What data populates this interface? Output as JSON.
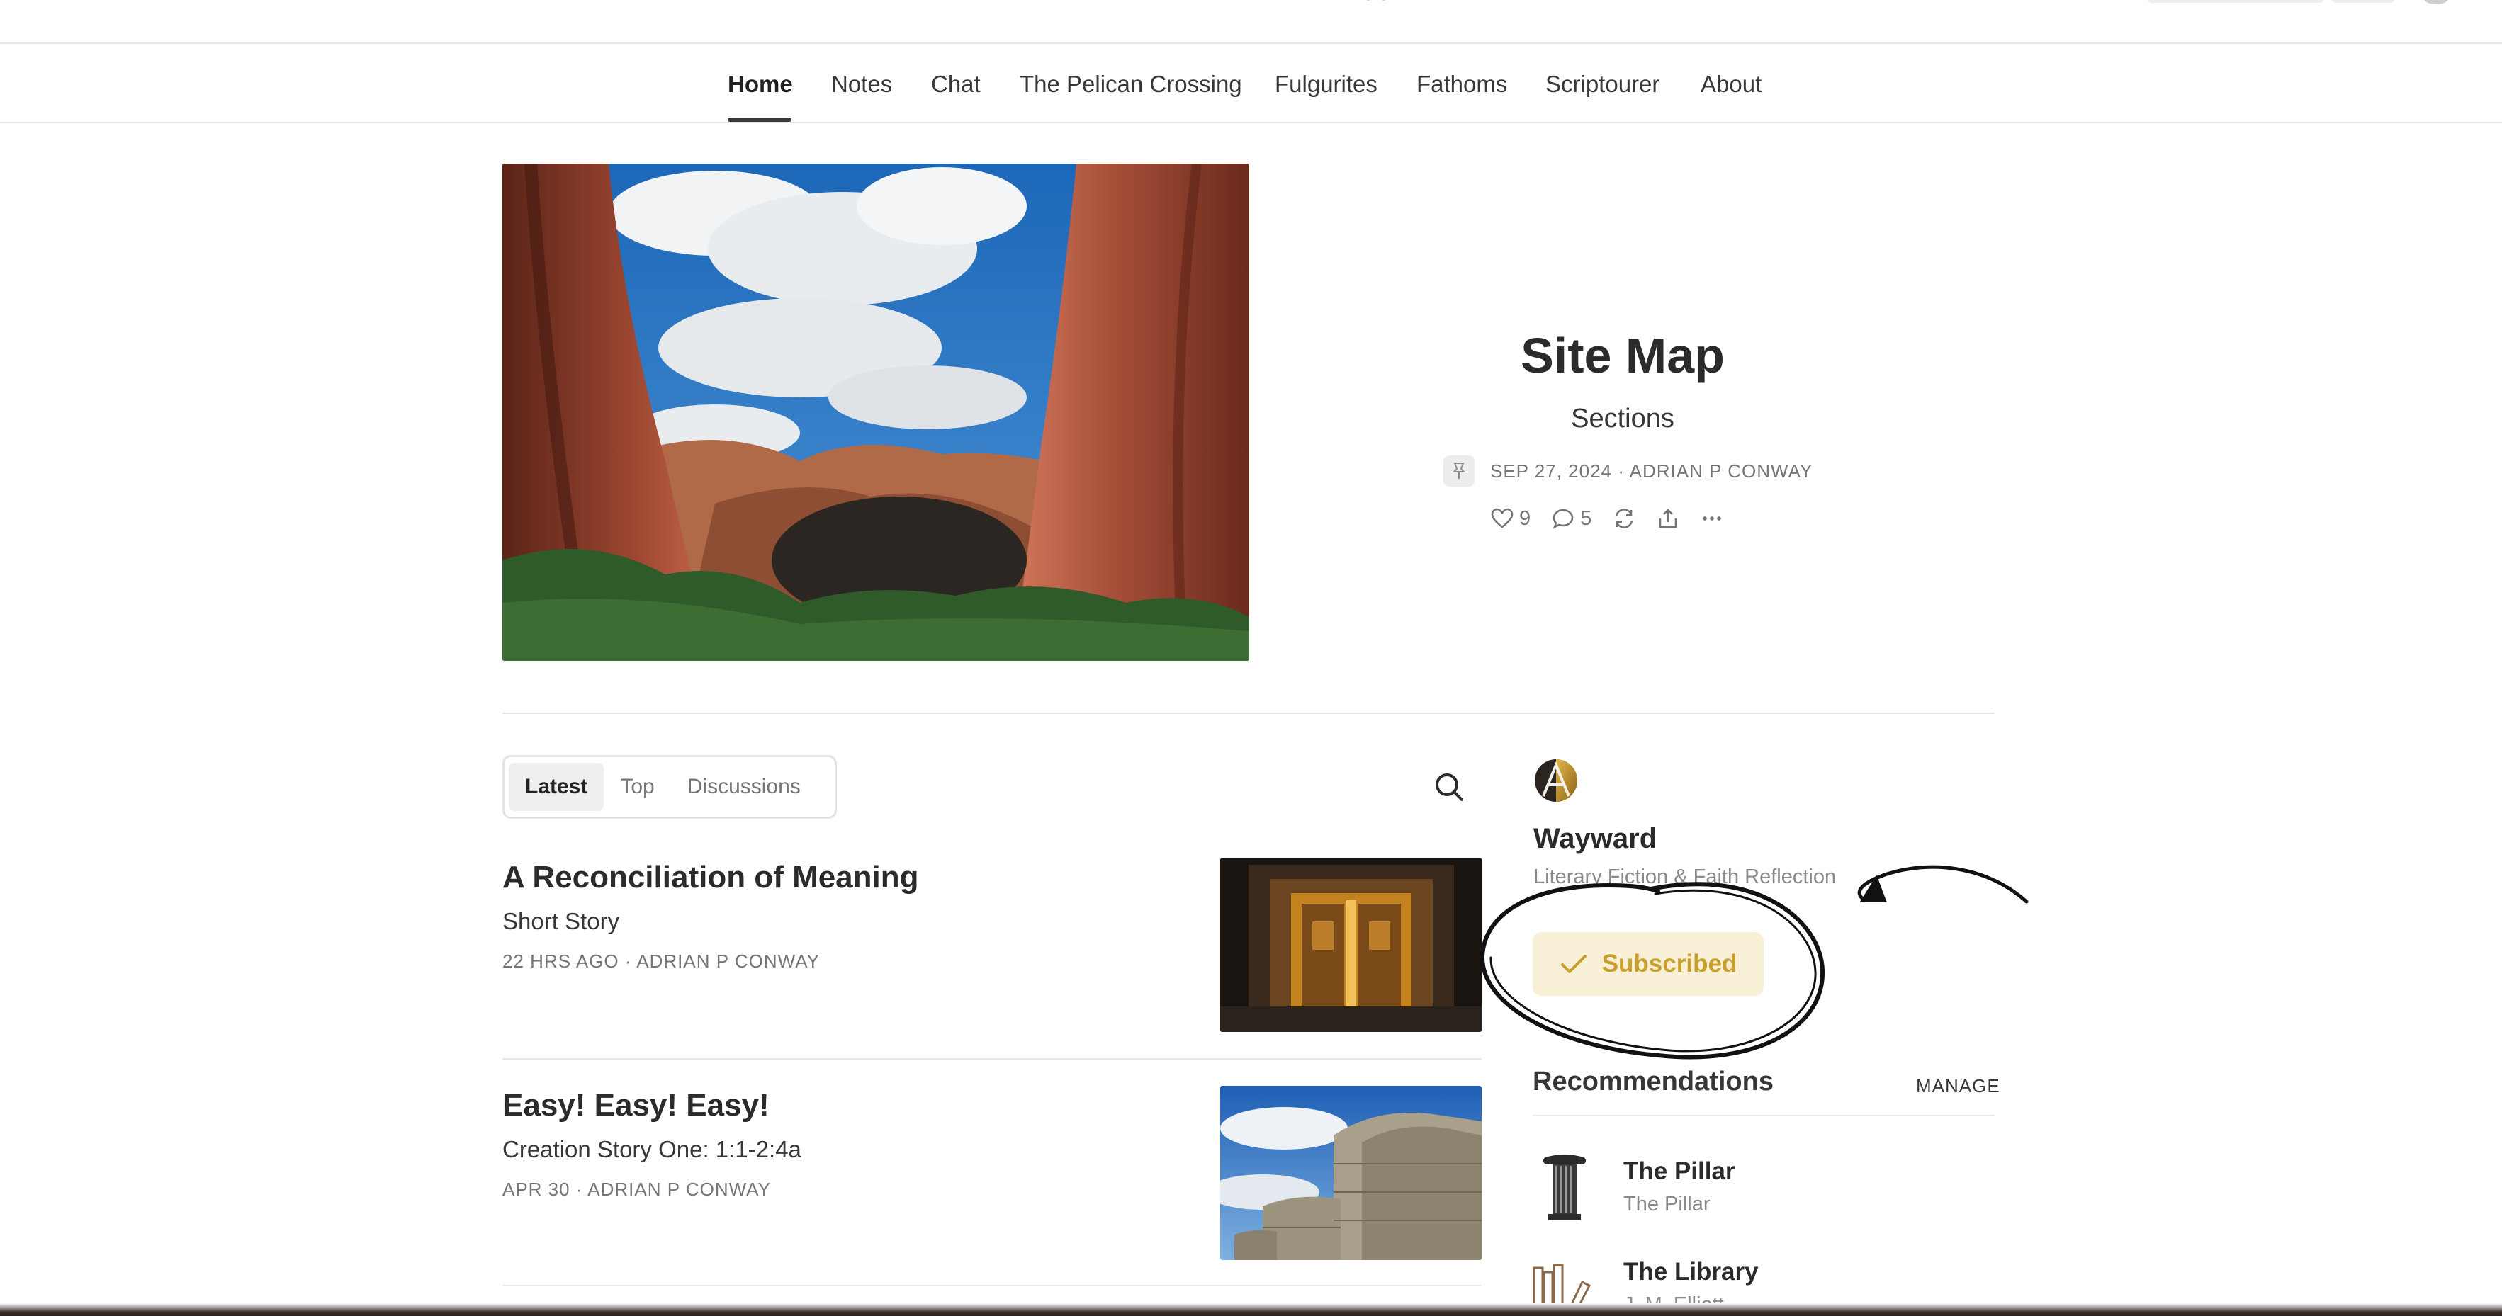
{
  "nav": {
    "items": [
      {
        "label": "Home",
        "active": true
      },
      {
        "label": "Notes"
      },
      {
        "label": "Chat"
      },
      {
        "label": "The Pelican Crossing"
      },
      {
        "label": "Fulgurites"
      },
      {
        "label": "Fathoms"
      },
      {
        "label": "Scriptourer"
      },
      {
        "label": "About"
      }
    ]
  },
  "hero": {
    "title": "Site Map",
    "subtitle": "Sections",
    "meta": "SEP 27, 2024 · ADRIAN P CONWAY",
    "likes": "9",
    "comments": "5",
    "icons": [
      "pin-icon",
      "heart-icon",
      "comment-icon",
      "restack-icon",
      "share-icon",
      "more-icon"
    ]
  },
  "tabs": [
    "Latest",
    "Top",
    "Discussions"
  ],
  "posts": [
    {
      "title": "A Reconciliation of Meaning",
      "subtitle": "Short Story",
      "meta": "22 HRS AGO · ADRIAN P CONWAY"
    },
    {
      "title": "Easy! Easy! Easy!",
      "subtitle": "Creation Story One: 1:1-2:4a",
      "meta": "APR 30 · ADRIAN P CONWAY"
    }
  ],
  "publication": {
    "name": "Wayward",
    "tagline": "Literary Fiction & Faith Reflection",
    "subscribed_label": "Subscribed"
  },
  "recommendations": {
    "title": "Recommendations",
    "manage_label": "MANAGE",
    "items": [
      {
        "name": "The Pillar",
        "author": "The Pillar"
      },
      {
        "name": "The Library",
        "author": "J. M. Elliott"
      }
    ]
  },
  "colors": {
    "accent": "#c89f2a",
    "subscribed_bg": "#f8f0d6",
    "text": "#363737",
    "muted": "#757575"
  }
}
